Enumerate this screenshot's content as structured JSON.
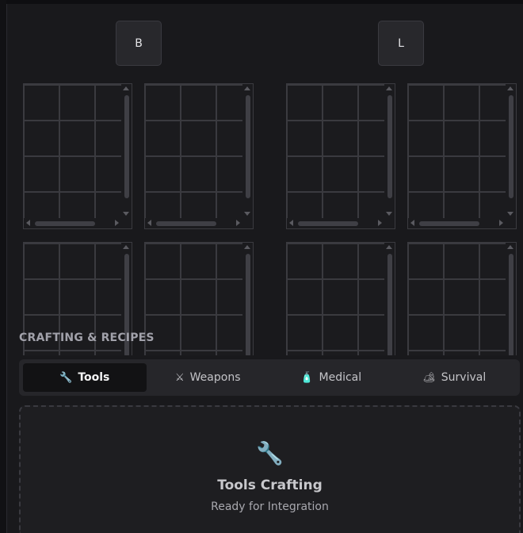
{
  "bags": {
    "left_label": "B",
    "right_label": "L"
  },
  "crafting": {
    "title": "CRAFTING & RECIPES",
    "tabs": [
      {
        "icon": "🔧",
        "icon_name": "wrench-icon",
        "label": "Tools",
        "active": true
      },
      {
        "icon": "⚔",
        "icon_name": "crossed-swords-icon",
        "label": "Weapons",
        "active": false
      },
      {
        "icon": "🧴",
        "icon_name": "medical-bottle-icon",
        "label": "Medical",
        "active": false
      },
      {
        "icon": "🏕",
        "icon_name": "camping-icon",
        "label": "Survival",
        "active": false
      }
    ],
    "panel": {
      "icon": "🔧",
      "icon_name": "wrench-icon",
      "title": "Tools Crafting",
      "subtitle": "Ready for Integration"
    }
  },
  "colors": {
    "background": "#19191c",
    "tab_active": "#121214",
    "tab_bar": "#26262a",
    "grid_line": "#3a3a3f"
  }
}
